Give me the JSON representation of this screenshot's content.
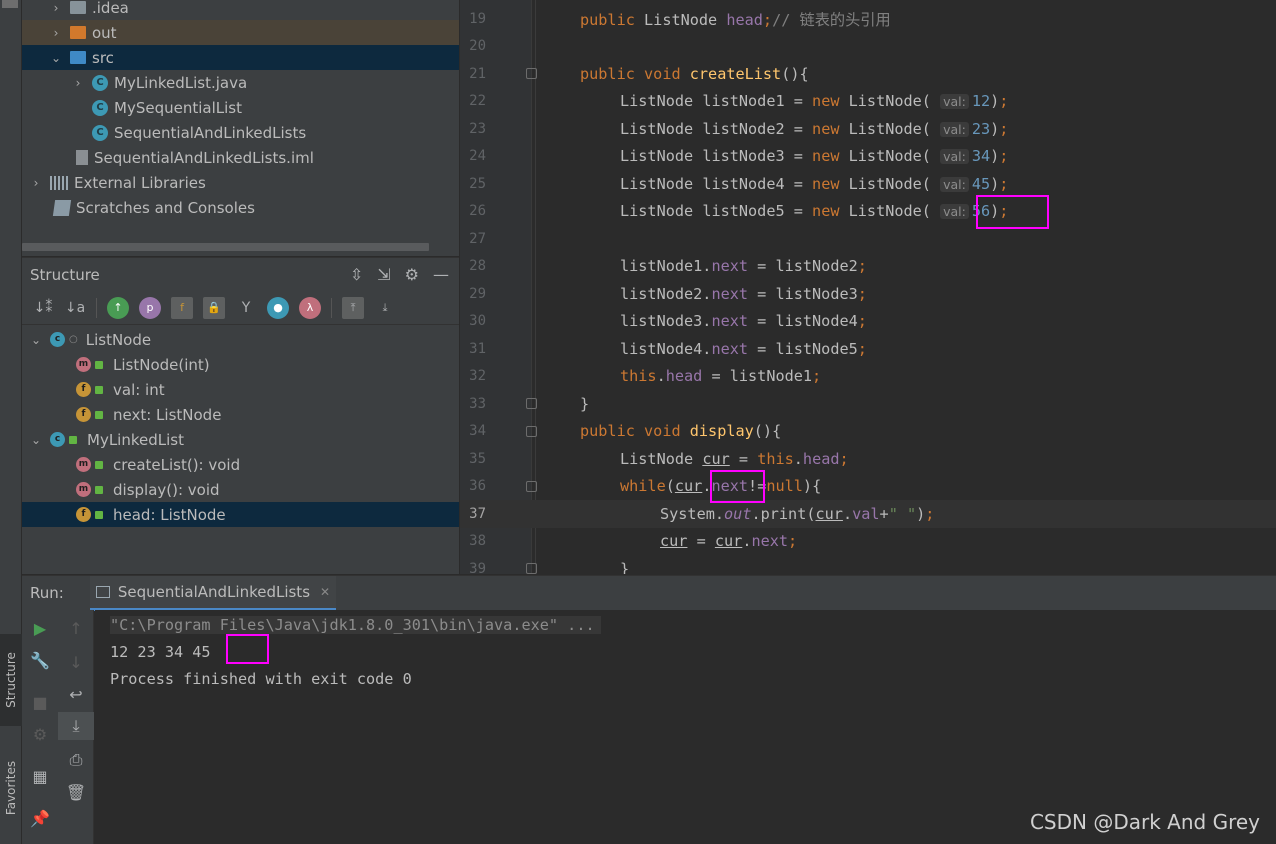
{
  "project_tree": [
    {
      "label": ".idea",
      "icon": "folder-icon",
      "chevron": "›",
      "indent": 1
    },
    {
      "label": "out",
      "icon": "folder-orange-icon",
      "chevron": "›",
      "indent": 1
    },
    {
      "label": "src",
      "icon": "folder-blue-icon",
      "chevron": "⌄",
      "indent": 1
    },
    {
      "label": "MyLinkedList.java",
      "icon": "class-icon",
      "chevron": "›",
      "indent": 2
    },
    {
      "label": "MySequentialList",
      "icon": "class-icon",
      "chevron": "",
      "indent": 2
    },
    {
      "label": "SequentialAndLinkedLists",
      "icon": "class-run-icon",
      "chevron": "",
      "indent": 2
    },
    {
      "label": "SequentialAndLinkedLists.iml",
      "icon": "iml-file-icon",
      "chevron": "",
      "indent": 1
    },
    {
      "label": "External Libraries",
      "icon": "library-icon",
      "chevron": "›",
      "indent": 0
    },
    {
      "label": "Scratches and Consoles",
      "icon": "scratch-icon",
      "chevron": "",
      "indent": 0
    }
  ],
  "structure": {
    "title": "Structure",
    "items": [
      {
        "label": "ListNode",
        "kind": "c",
        "chevron": "⌄",
        "indent": 0
      },
      {
        "label": "ListNode(int)",
        "kind": "m",
        "chevron": "",
        "indent": 1
      },
      {
        "label": "val: int",
        "kind": "f",
        "chevron": "",
        "indent": 1
      },
      {
        "label": "next: ListNode",
        "kind": "f",
        "chevron": "",
        "indent": 1
      },
      {
        "label": "MyLinkedList",
        "kind": "c",
        "chevron": "⌄",
        "indent": 0
      },
      {
        "label": "createList(): void",
        "kind": "m",
        "chevron": "",
        "indent": 1
      },
      {
        "label": "display(): void",
        "kind": "m",
        "chevron": "",
        "indent": 1
      },
      {
        "label": "head: ListNode",
        "kind": "f",
        "chevron": "",
        "indent": 1
      }
    ]
  },
  "editor": {
    "current_line": "37",
    "lines": [
      {
        "n": "19"
      },
      {
        "n": "20"
      },
      {
        "n": "21"
      },
      {
        "n": "22"
      },
      {
        "n": "23"
      },
      {
        "n": "24"
      },
      {
        "n": "25"
      },
      {
        "n": "26"
      },
      {
        "n": "27"
      },
      {
        "n": "28"
      },
      {
        "n": "29"
      },
      {
        "n": "30"
      },
      {
        "n": "31"
      },
      {
        "n": "32"
      },
      {
        "n": "33"
      },
      {
        "n": "34"
      },
      {
        "n": "35"
      },
      {
        "n": "36"
      },
      {
        "n": "37"
      },
      {
        "n": "38"
      },
      {
        "n": "39"
      }
    ],
    "tokens": {
      "public": "public",
      "void": "void",
      "new": "new",
      "this": "this",
      "while": "while",
      "ListNode": "ListNode",
      "head": "head",
      "comment": "// 链表的头引用",
      "createList": "createList",
      "display": "display",
      "listNode1": "listNode1",
      "listNode2": "listNode2",
      "listNode3": "listNode3",
      "listNode4": "listNode4",
      "listNode5": "listNode5",
      "val_hint": "val:",
      "v1": "12",
      "v2": "23",
      "v3": "34",
      "v4": "45",
      "v5": "56",
      "next": "next",
      "cur": "cur",
      "val": "val",
      "null": "null",
      "System": "System",
      "out": "out",
      "print": "print",
      "space_str": "\" \""
    }
  },
  "run": {
    "label": "Run:",
    "tab": "SequentialAndLinkedLists",
    "console": [
      "\"C:\\Program Files\\Java\\jdk1.8.0_301\\bin\\java.exe\" ...",
      "12 23 34 45",
      "Process finished with exit code 0"
    ]
  },
  "side_tabs": {
    "structure": "Structure",
    "favorites": "Favorites"
  },
  "watermark": "CSDN @Dark And Grey",
  "colors": {
    "highlight": "#ff00ff",
    "keyword": "#cc7832",
    "number": "#6897bb",
    "field": "#9876aa",
    "method": "#ffc66d"
  }
}
